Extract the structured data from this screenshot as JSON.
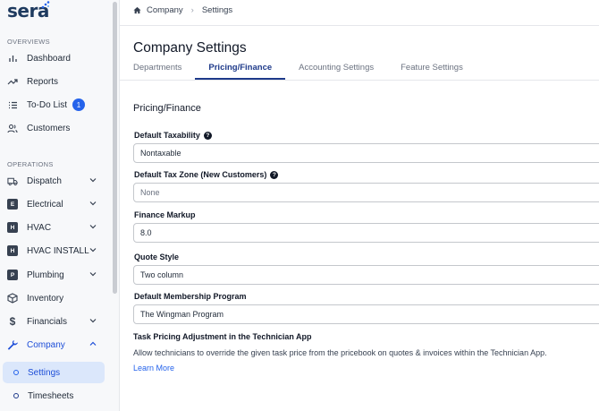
{
  "brand": {
    "name": "sera"
  },
  "sidebar": {
    "overviews_label": "OVERVIEWS",
    "operations_label": "OPERATIONS",
    "overview_items": [
      {
        "label": "Dashboard",
        "icon": "bar-chart-icon"
      },
      {
        "label": "Reports",
        "icon": "trend-icon"
      },
      {
        "label": "To-Do List",
        "icon": "list-icon",
        "badge": "1"
      },
      {
        "label": "Customers",
        "icon": "users-icon"
      }
    ],
    "operation_items": [
      {
        "label": "Dispatch",
        "icon": "truck-icon"
      },
      {
        "label": "Electrical",
        "letter": "E"
      },
      {
        "label": "HVAC",
        "letter": "H"
      },
      {
        "label": "HVAC INSTALL",
        "letter": "H"
      },
      {
        "label": "Plumbing",
        "letter": "P"
      },
      {
        "label": "Inventory",
        "icon": "box-icon"
      },
      {
        "label": "Financials",
        "icon": "dollar-icon"
      },
      {
        "label": "Company",
        "icon": "wrench-icon"
      }
    ],
    "company_sub": [
      {
        "label": "Settings"
      },
      {
        "label": "Timesheets"
      }
    ]
  },
  "breadcrumb": {
    "first": "Company",
    "second": "Settings"
  },
  "page": {
    "title": "Company Settings",
    "tabs": [
      "Departments",
      "Pricing/Finance",
      "Accounting Settings",
      "Feature Settings"
    ],
    "section_title": "Pricing/Finance"
  },
  "form": {
    "taxability_label": "Default Taxability",
    "taxability_value": "Nontaxable",
    "taxzone_label": "Default Tax Zone (New Customers)",
    "taxzone_value": "None",
    "markup_label": "Finance Markup",
    "markup_value": "8.0",
    "quote_label": "Quote Style",
    "quote_value": "Two column",
    "membership_label": "Default Membership Program",
    "membership_value": "The Wingman Program"
  },
  "adjustment": {
    "title": "Task Pricing Adjustment in the Technician App",
    "description": "Allow technicians to override the given task price from the pricebook on quotes & invoices within the Technician App.",
    "link": "Learn More"
  },
  "colors": {
    "accent": "#1e3a8a",
    "link": "#2563eb",
    "selected_bg": "#dbe7fb"
  }
}
